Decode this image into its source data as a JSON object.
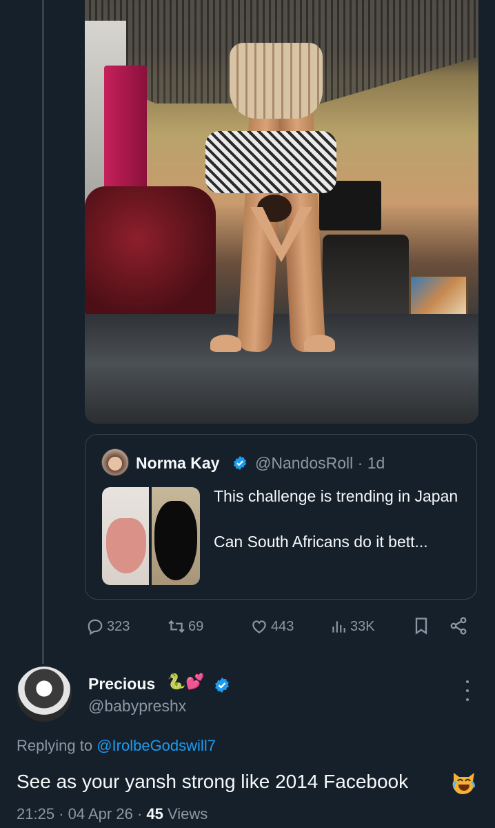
{
  "quoted_tweet": {
    "name": "Norma Kay",
    "handle": "@NandosRoll",
    "separator": "·",
    "time": "1d",
    "text_line1": "This challenge is trending in Japan",
    "text_line2": "Can South Africans do it bett..."
  },
  "actions": {
    "replies": "323",
    "retweets": "69",
    "likes": "443",
    "views": "33K"
  },
  "reply": {
    "name": "Precious",
    "name_emoji": "🐍💕",
    "handle": "@babypreshx",
    "replying_prefix": "Replying to",
    "replying_to": "@IrolbeGodswill7",
    "text": "See as your yansh strong like 2014 Facebook",
    "time": "21:25",
    "date": "04 Apr 26",
    "views_count": "45",
    "views_label": "Views",
    "sep": "·"
  },
  "colors": {
    "background": "#15202b",
    "accent": "#1d9bf0",
    "muted": "#8b98a5",
    "text": "#f7f9f9",
    "border": "#38444d"
  },
  "icons": [
    "reply-icon",
    "retweet-icon",
    "like-icon",
    "views-icon",
    "bookmark-icon",
    "share-icon",
    "verified-icon",
    "more-icon",
    "laughing-cat-emoji-icon"
  ]
}
